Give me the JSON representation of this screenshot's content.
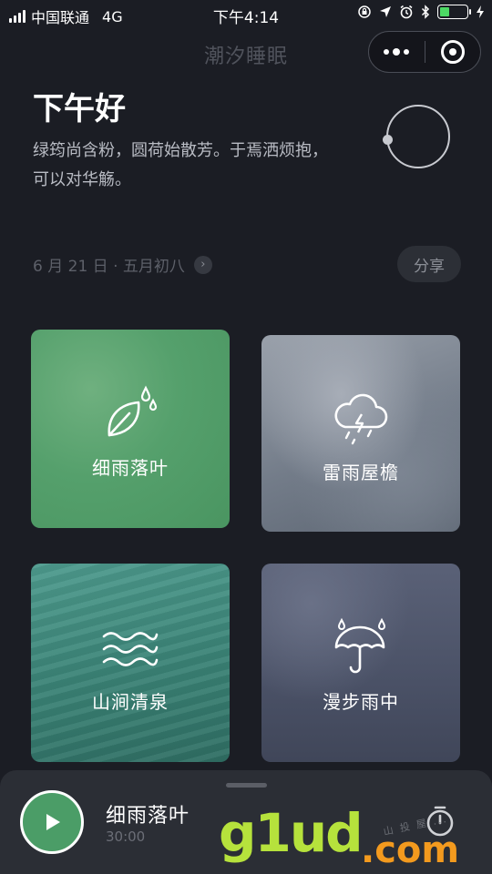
{
  "status_bar": {
    "carrier": "中国联通",
    "network": "4G",
    "time": "下午4:14",
    "battery_level": 0.35
  },
  "nav": {
    "title": "潮汐睡眠"
  },
  "header": {
    "greeting": "下午好",
    "poem_line1": "绿筠尚含粉，圆荷始散芳。于焉洒烦抱，",
    "poem_line2": "可以对华觞。"
  },
  "date": {
    "text": "6 月 21 日 · 五月初八",
    "arrow": "›"
  },
  "share_label": "分享",
  "cards": [
    {
      "label": "细雨落叶",
      "icon": "leaf-rain-icon",
      "color": "#55a06c"
    },
    {
      "label": "雷雨屋檐",
      "icon": "thunder-cloud-icon",
      "color": "#7c8592"
    },
    {
      "label": "山涧清泉",
      "icon": "waves-icon",
      "color": "#3c8578"
    },
    {
      "label": "漫步雨中",
      "icon": "umbrella-rain-icon",
      "color": "#4a5166"
    }
  ],
  "player": {
    "title": "细雨落叶",
    "duration": "30:00",
    "accent": "#4b9d67"
  },
  "watermark": {
    "text": "g1ud",
    "suffix": ".com",
    "small": "山 投 屋 ..."
  }
}
